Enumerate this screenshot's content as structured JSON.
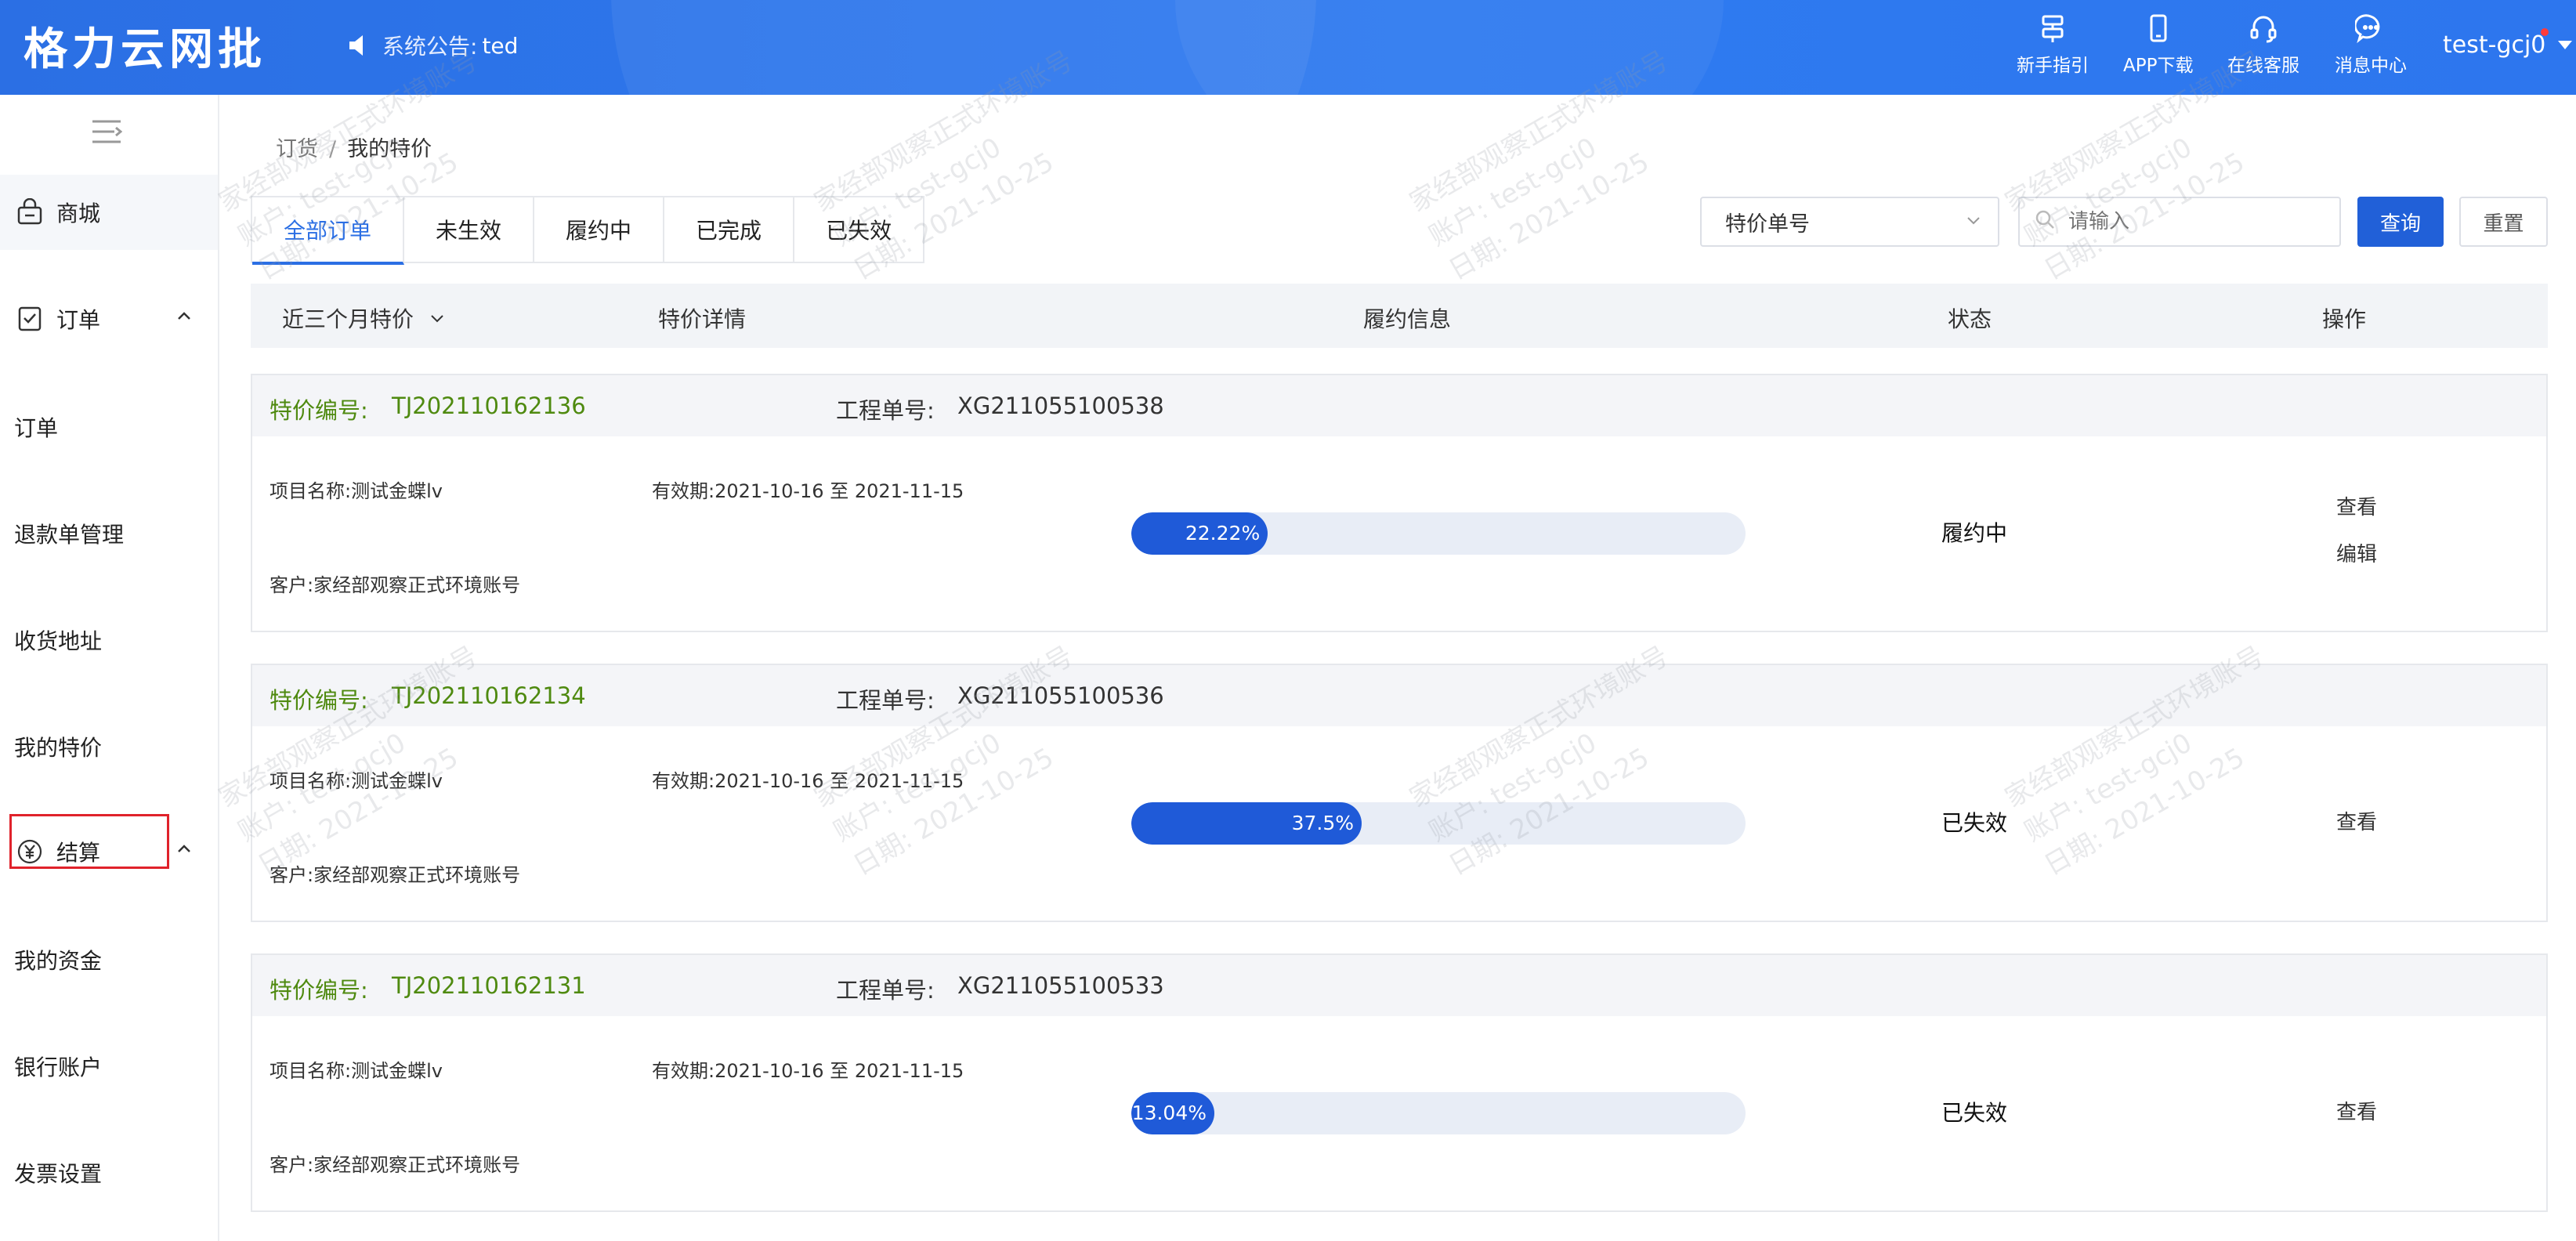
{
  "header": {
    "logo": "格力云网批",
    "notice_label": "系统公告:",
    "notice_value": "ted",
    "nav": [
      {
        "label": "新手指引",
        "icon": "guide-icon"
      },
      {
        "label": "APP下载",
        "icon": "phone-icon"
      },
      {
        "label": "在线客服",
        "icon": "headset-icon"
      },
      {
        "label": "消息中心",
        "icon": "message-icon"
      }
    ],
    "user": "test-gcj0"
  },
  "sidebar": {
    "mall": "商城",
    "order_group": "订单",
    "order_items": [
      "订单",
      "退款单管理",
      "收货地址",
      "我的特价"
    ],
    "settle_group": "结算",
    "settle_items": [
      "我的资金",
      "银行账户",
      "发票设置"
    ]
  },
  "breadcrumb": {
    "parent": "订货",
    "sep": "/",
    "current": "我的特价"
  },
  "tabs": [
    "全部订单",
    "未生效",
    "履约中",
    "已完成",
    "已失效"
  ],
  "filters": {
    "select_value": "特价单号",
    "search_placeholder": "请输入",
    "query": "查询",
    "reset": "重置"
  },
  "table_header": {
    "period": "近三个月特价",
    "detail": "特价详情",
    "perform": "履约信息",
    "status": "状态",
    "ops": "操作"
  },
  "orders": [
    {
      "no_label": "特价编号:",
      "no": "TJ202110162136",
      "wo_label": "工程单号:",
      "wo": "XG211055100538",
      "project": "项目名称:测试金蝶lv",
      "validity": "有效期:2021-10-16 至 2021-11-15",
      "customer": "客户:家经部观察正式环境账号",
      "progress_label": "22.22%",
      "progress": 22.22,
      "status": "履约中",
      "actions": [
        "查看",
        "编辑"
      ]
    },
    {
      "no_label": "特价编号:",
      "no": "TJ202110162134",
      "wo_label": "工程单号:",
      "wo": "XG211055100536",
      "project": "项目名称:测试金蝶lv",
      "validity": "有效期:2021-10-16 至 2021-11-15",
      "customer": "客户:家经部观察正式环境账号",
      "progress_label": "37.5%",
      "progress": 37.5,
      "status": "已失效",
      "actions": [
        "查看"
      ]
    },
    {
      "no_label": "特价编号:",
      "no": "TJ202110162131",
      "wo_label": "工程单号:",
      "wo": "XG211055100533",
      "project": "项目名称:测试金蝶lv",
      "validity": "有效期:2021-10-16 至 2021-11-15",
      "customer": "客户:家经部观察正式环境账号",
      "progress_label": "13.04%",
      "progress": 13.04,
      "status": "已失效",
      "actions": [
        "查看"
      ]
    }
  ],
  "watermark": {
    "line1": "家经部观察正式环境账号",
    "line2": "账户: test-gcj0",
    "line3": "日期: 2021-10-25"
  },
  "colors": {
    "primary": "#2b6fe4",
    "order_no": "#4f8a10",
    "progress": "#1f5ad8",
    "highlight_box": "#e0222b"
  }
}
